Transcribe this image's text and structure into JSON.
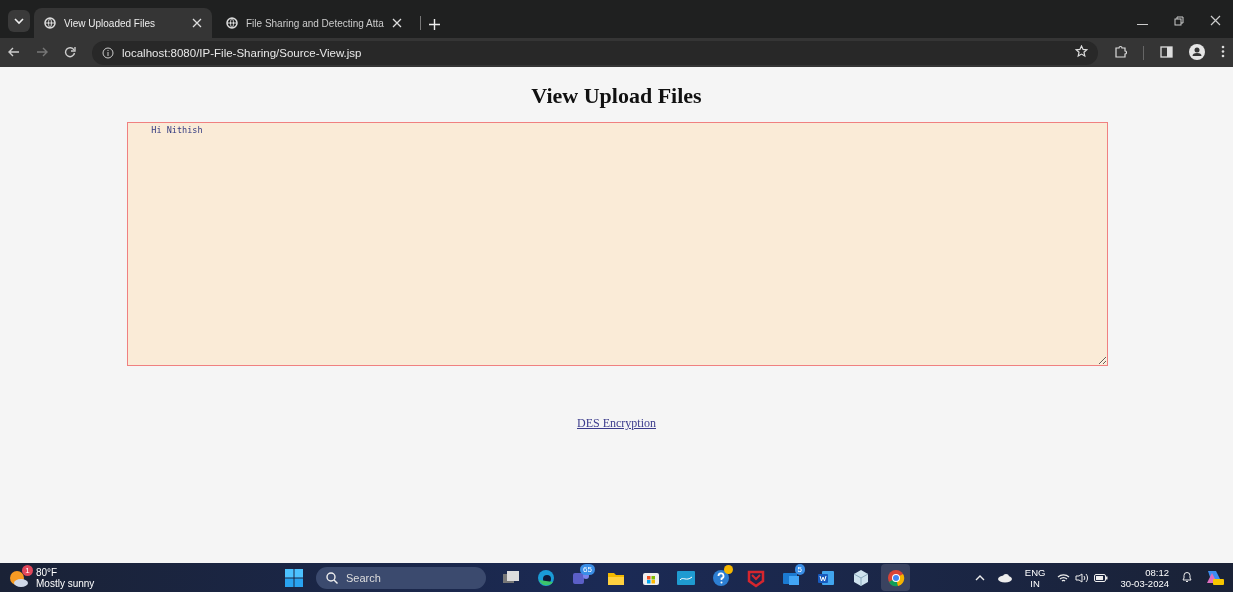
{
  "browser": {
    "tabs": [
      {
        "title": "View Uploaded Files",
        "selected": true
      },
      {
        "title": "File Sharing and Detecting Atta",
        "selected": false
      }
    ],
    "url": "localhost:8080/IP-File-Sharing/Source-View.jsp"
  },
  "page": {
    "heading": "View Upload Files",
    "textarea_value": "   Hi Nithish",
    "link": "DES Encryption"
  },
  "taskbar": {
    "weather": {
      "badge": "1",
      "temperature": "80°F",
      "condition": "Mostly sunny"
    },
    "search_label": "Search",
    "apps": [
      {
        "kind": "taskview"
      },
      {
        "kind": "edge"
      },
      {
        "kind": "teams",
        "badge": "65"
      },
      {
        "kind": "folder"
      },
      {
        "kind": "store"
      },
      {
        "kind": "mylp"
      },
      {
        "kind": "help",
        "dot": true
      },
      {
        "kind": "shield"
      },
      {
        "kind": "mail",
        "badge": "5"
      },
      {
        "kind": "word"
      },
      {
        "kind": "cube"
      },
      {
        "kind": "chrome",
        "selected": true
      }
    ],
    "language": "ENG",
    "region": "IN",
    "time": "08:12",
    "date": "30-03-2024"
  }
}
